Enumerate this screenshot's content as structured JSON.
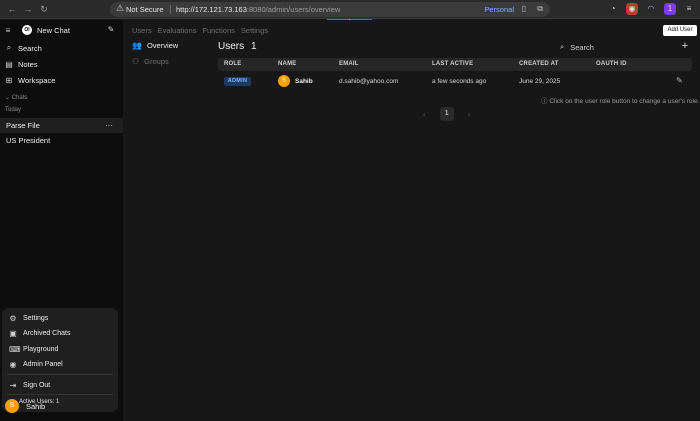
{
  "browser": {
    "security_label": "Not Secure",
    "url_host": "http://172.121.73.163",
    "url_path": ":8080/admin/users/overview",
    "profile_label": "Personal",
    "ext_badge": "1"
  },
  "sidebar": {
    "new_chat": "New Chat",
    "logo_text": "OI",
    "nav": [
      {
        "label": "Search",
        "icon": "search-icon"
      },
      {
        "label": "Notes",
        "icon": "notes-icon"
      },
      {
        "label": "Workspace",
        "icon": "workspace-icon"
      }
    ],
    "chats_label": "Chats",
    "today_label": "Today",
    "chats": [
      "Parse File",
      "US President"
    ]
  },
  "user_menu": {
    "items": [
      "Settings",
      "Archived Chats",
      "Playground",
      "Admin Panel"
    ],
    "sign_out": "Sign Out",
    "active_users": "Active Users: 1"
  },
  "user": {
    "name": "Sahib",
    "initial": "S"
  },
  "admin": {
    "tabs": [
      "Users",
      "Evaluations",
      "Functions",
      "Settings"
    ],
    "subnav": [
      "Overview",
      "Groups"
    ],
    "title": "Users",
    "count": "1",
    "search_placeholder": "Search",
    "add_tooltip": "Add User",
    "columns": [
      "ROLE",
      "NAME",
      "EMAIL",
      "LAST ACTIVE",
      "CREATED AT",
      "OAUTH ID"
    ],
    "rows": [
      {
        "role": "ADMIN",
        "name": "Sahib",
        "initial": "S",
        "email": "d.sahib@yahoo.com",
        "last_active": "a few seconds ago",
        "created_at": "June 29, 2025",
        "oauth_id": ""
      }
    ],
    "hint": "Click on the user role button to change a user's role.",
    "page": "1"
  },
  "colors": {
    "accent": "#f59e0b",
    "badge_bg": "#1e3a5f",
    "badge_text": "#7fb8ff",
    "active_dot": "#22c55e",
    "banner": "#e03b2e"
  }
}
